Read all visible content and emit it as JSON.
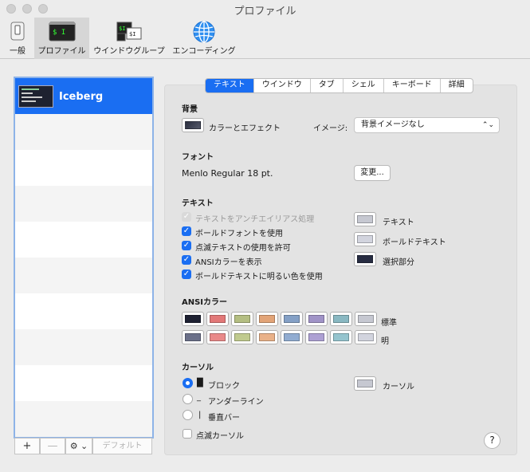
{
  "window": {
    "title": "プロファイル"
  },
  "toolbar": {
    "items": [
      {
        "label": "一般",
        "icon": "switch-icon"
      },
      {
        "label": "プロファイル",
        "icon": "terminal-icon"
      },
      {
        "label": "ウインドウグループ",
        "icon": "window-group-icon"
      },
      {
        "label": "エンコーディング",
        "icon": "globe-icon"
      }
    ]
  },
  "sidebar": {
    "profiles": [
      {
        "name": "Iceberg"
      }
    ],
    "buttons": {
      "add": "+",
      "remove": "—",
      "action": "⚙ ⌄",
      "default": "デフォルト"
    }
  },
  "tabs": [
    {
      "label": "テキスト"
    },
    {
      "label": "ウインドウ"
    },
    {
      "label": "タブ"
    },
    {
      "label": "シェル"
    },
    {
      "label": "キーボード"
    },
    {
      "label": "詳細"
    }
  ],
  "background": {
    "section": "背景",
    "color_effect_label": "カラーとエフェクト",
    "image_label": "イメージ:",
    "image_value": "背景イメージなし"
  },
  "font": {
    "section": "フォント",
    "value": "Menlo Regular 18 pt.",
    "change_button": "変更..."
  },
  "text": {
    "section": "テキスト",
    "checkboxes": [
      {
        "label": "テキストをアンチエイリアス処理",
        "checked": true,
        "disabled": true
      },
      {
        "label": "ボールドフォントを使用",
        "checked": true
      },
      {
        "label": "点滅テキストの使用を許可",
        "checked": true
      },
      {
        "label": "ANSIカラーを表示",
        "checked": true
      },
      {
        "label": "ボールドテキストに明るい色を使用",
        "checked": true
      }
    ],
    "colors": [
      {
        "label": "テキスト",
        "color": "#c6c8d1"
      },
      {
        "label": "ボールドテキスト",
        "color": "#d2d4de"
      },
      {
        "label": "選択部分",
        "color": "#272c42"
      }
    ]
  },
  "ansi": {
    "section": "ANSIカラー",
    "normal_label": "標準",
    "bright_label": "明",
    "normal": [
      "#1e2132",
      "#e27878",
      "#b4be82",
      "#e2a478",
      "#84a0c6",
      "#a093c7",
      "#89b8c2",
      "#c6c8d1"
    ],
    "bright": [
      "#6b7089",
      "#e98989",
      "#c0ca8e",
      "#e9b189",
      "#91acd1",
      "#ada0d3",
      "#95c4ce",
      "#d2d4de"
    ]
  },
  "cursor": {
    "section": "カーソル",
    "options": [
      {
        "glyph": "█",
        "label": "ブロック",
        "selected": true
      },
      {
        "glyph": "_",
        "label": "アンダーライン",
        "selected": false
      },
      {
        "glyph": "|",
        "label": "垂直バー",
        "selected": false
      }
    ],
    "blink_label": "点滅カーソル",
    "color_label": "カーソル",
    "color": "#c6c8d1"
  },
  "help": "?"
}
